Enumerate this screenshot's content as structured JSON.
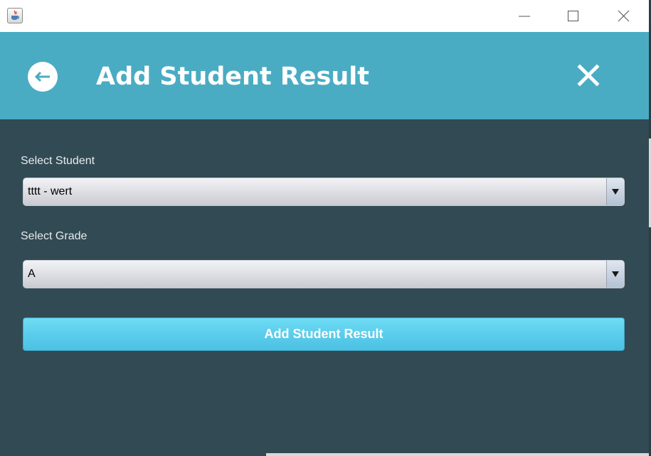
{
  "window": {
    "app_icon": "java-cup-icon",
    "controls": [
      "minimize-icon",
      "maximize-icon",
      "close-icon"
    ]
  },
  "header": {
    "title": "Add Student Result",
    "back_icon": "back-arrow-icon",
    "close_icon": "close-icon",
    "background": "#4aacc3"
  },
  "form": {
    "background": "#324a53",
    "student_label": "Select Student",
    "student_selected": "tttt - wert",
    "grade_label": "Select Grade",
    "grade_selected": "A",
    "submit_label": "Add Student Result"
  }
}
